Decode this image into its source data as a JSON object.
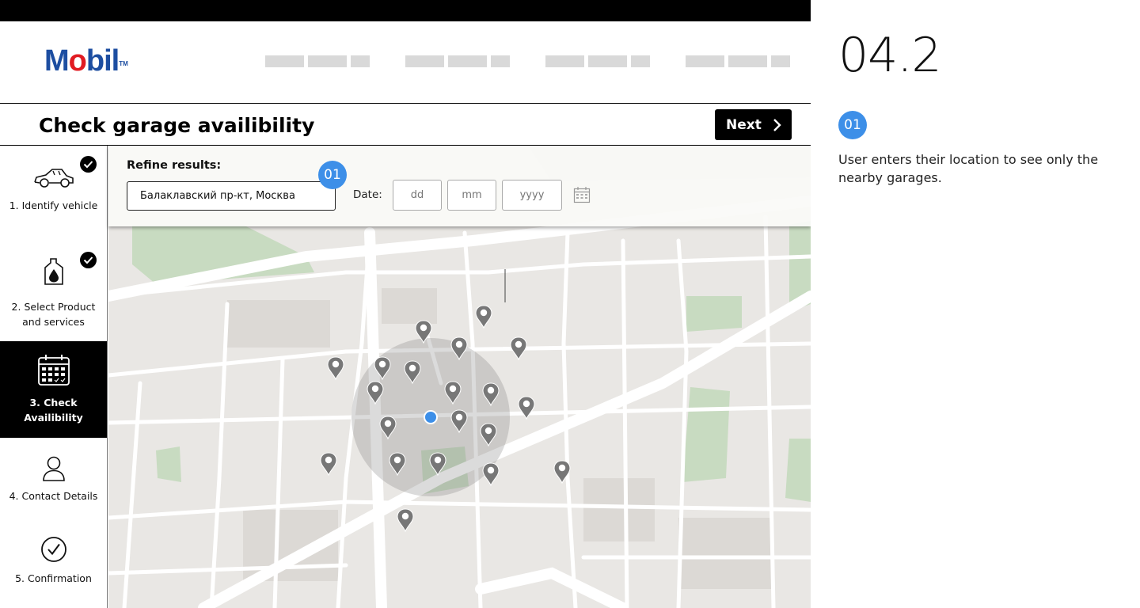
{
  "header": {
    "logo_text": "Mobil",
    "nav_placeholder_count": 4
  },
  "titlebar": {
    "title": "Check garage availibility",
    "next_label": "Next"
  },
  "sidebar": {
    "steps": [
      {
        "label": "1. Identify vehicle",
        "icon": "car-icon",
        "completed": true,
        "active": false
      },
      {
        "label": "2. Select Product and services",
        "icon": "oil-bottle-icon",
        "completed": true,
        "active": false
      },
      {
        "label": "3. Check Availibility",
        "icon": "calendar-icon",
        "completed": false,
        "active": true
      },
      {
        "label": "4. Contact Details",
        "icon": "person-icon",
        "completed": false,
        "active": false
      },
      {
        "label": "5. Confirmation",
        "icon": "check-circle-icon",
        "completed": false,
        "active": false
      }
    ]
  },
  "filter": {
    "refine_label": "Refine results:",
    "location_value": "Балаклавский пр-кт, Москва",
    "date_label": "Date:",
    "day_placeholder": "dd",
    "month_placeholder": "mm",
    "year_placeholder": "yyyy",
    "badge": "01"
  },
  "map": {
    "garage_pin_count": 20,
    "user_location_color": "#3d8fe8"
  },
  "annotation": {
    "section": "04.2",
    "badge": "01",
    "text": "User enters their location to see only the nearby garages."
  },
  "colors": {
    "brand_blue": "#1d4ea1",
    "brand_red": "#e11b22",
    "badge_blue": "#3d8fe8",
    "active_step": "#000000"
  }
}
